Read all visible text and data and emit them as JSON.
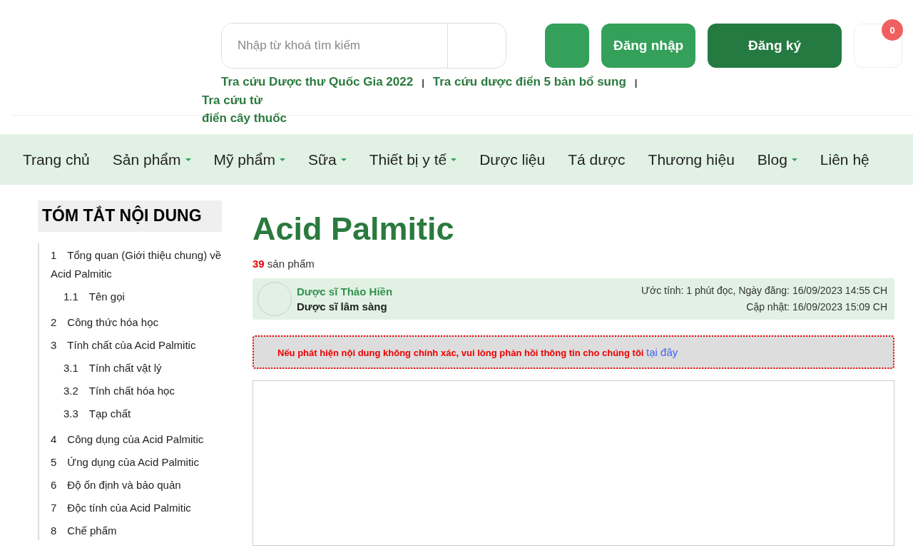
{
  "search": {
    "placeholder": "Nhập từ khoá tìm kiếm"
  },
  "buttons": [
    {
      "label": "Đăng nhập",
      "kind": "light"
    },
    {
      "label": "Đăng ký",
      "kind": "dark"
    }
  ],
  "cart": {
    "count": "0"
  },
  "quick_links": [
    {
      "label": "Tra cứu Dược thư Quốc Gia 2022"
    },
    {
      "separator": "|",
      "label": "Tra cứu dược điển 5 bản bổ sung"
    },
    {
      "separator": "|",
      "label": "Tra cứu từ điển cây thuốc"
    }
  ],
  "nav": [
    {
      "label": "Trang chủ",
      "dropdown": false
    },
    {
      "label": "Sản phẩm",
      "dropdown": true
    },
    {
      "label": "Mỹ phẩm",
      "dropdown": true
    },
    {
      "label": "Sữa",
      "dropdown": true
    },
    {
      "label": "Thiết bị y tế",
      "dropdown": true
    },
    {
      "label": "Dược liệu",
      "dropdown": false
    },
    {
      "label": "Tá dược",
      "dropdown": false
    },
    {
      "label": "Thương hiệu",
      "dropdown": false
    },
    {
      "label": "Blog",
      "dropdown": true
    },
    {
      "label": "Liên hệ",
      "dropdown": false
    }
  ],
  "toc": {
    "title": "TÓM TẮT NỘI DUNG",
    "items": [
      {
        "number": "1",
        "label": "Tổng quan (Giới thiệu chung) về Acid Palmitic",
        "children": [
          {
            "number": "1.1",
            "label": "Tên gọi"
          }
        ]
      },
      {
        "number": "2",
        "label": "Công thức hóa học"
      },
      {
        "number": "3",
        "label": "Tính chất của Acid Palmitic",
        "children": [
          {
            "number": "3.1",
            "label": "Tính chất vật lý"
          },
          {
            "number": "3.2",
            "label": "Tính chất hóa học"
          },
          {
            "number": "3.3",
            "label": "Tạp chất"
          }
        ]
      },
      {
        "number": "4",
        "label": "Công dụng của Acid Palmitic"
      },
      {
        "number": "5",
        "label": "Ứng dụng của Acid Palmitic"
      },
      {
        "number": "6",
        "label": "Độ ổn định và bảo quản"
      },
      {
        "number": "7",
        "label": "Độc tính của Acid Palmitic"
      },
      {
        "number": "8",
        "label": "Chế phẩm"
      }
    ]
  },
  "article": {
    "title": "Acid Palmitic",
    "product_count": "39",
    "product_label": "sản phẩm",
    "author": {
      "name": "Dược sĩ Thảo Hiền",
      "role": "Dược sĩ lâm sàng"
    },
    "meta": [
      "Ước tính: 1 phút đọc, Ngày đăng: 16/09/2023 14:55 CH",
      "Cập nhật: 16/09/2023 15:09 CH"
    ],
    "notice": {
      "text": "Nếu phát hiện nội dung không chính xác, vui lòng phản hồi thông tin cho chúng tôi",
      "link": "tại đây"
    }
  }
}
